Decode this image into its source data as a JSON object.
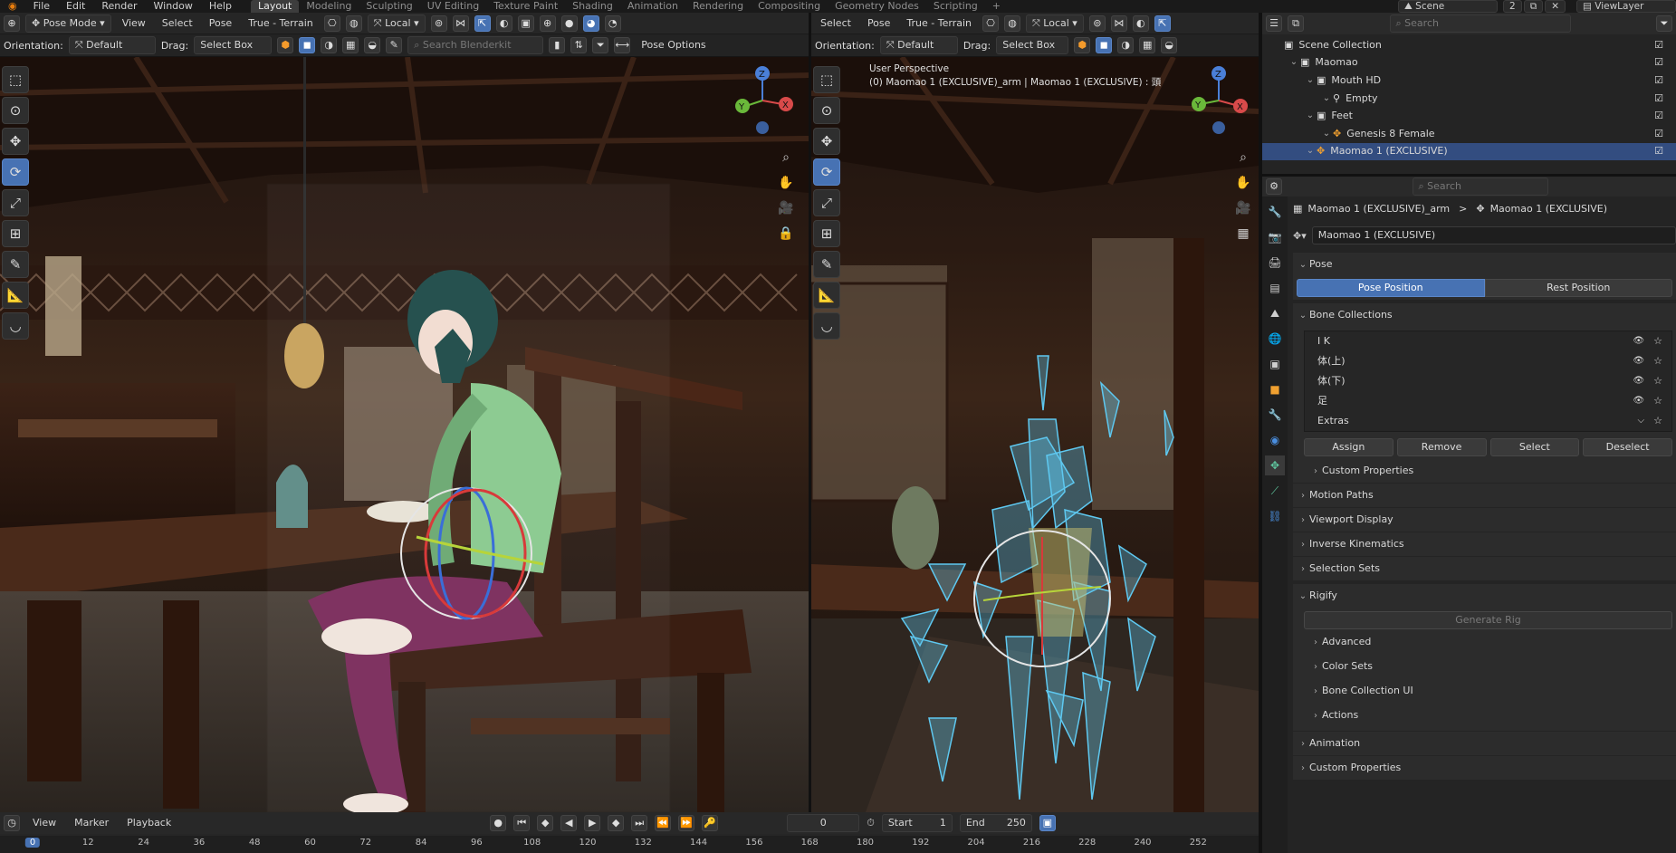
{
  "menubar": {
    "menus": [
      "File",
      "Edit",
      "Render",
      "Window",
      "Help"
    ],
    "workspaces": [
      "Layout",
      "Modeling",
      "Sculpting",
      "UV Editing",
      "Texture Paint",
      "Shading",
      "Animation",
      "Rendering",
      "Compositing",
      "Geometry Nodes",
      "Scripting"
    ],
    "active_workspace": "Layout",
    "add_workspace": "+",
    "scene_label": "Scene",
    "scene_count": "2",
    "view_layer_label": "ViewLayer"
  },
  "left_viewport": {
    "header1": {
      "mode": "Pose Mode",
      "view": "View",
      "select": "Select",
      "pose": "Pose",
      "snap_target": "True - Terrain",
      "pivot": "Local"
    },
    "header2": {
      "orientation_label": "Orientation:",
      "orientation_value": "Default",
      "drag_label": "Drag:",
      "drag_value": "Select Box",
      "search_placeholder": "Search Blenderkit",
      "pose_options": "Pose Options"
    },
    "gizmo_axes": [
      "Z",
      "X",
      "Y"
    ]
  },
  "right_viewport": {
    "header1": {
      "select": "Select",
      "pose": "Pose",
      "snap_target": "True - Terrain",
      "pivot": "Local"
    },
    "header2": {
      "orientation_label": "Orientation:",
      "orientation_value": "Default",
      "drag_label": "Drag:",
      "drag_value": "Select Box"
    },
    "overlay_line1": "User Perspective",
    "overlay_line2": "(0) Maomao 1 (EXCLUSIVE)_arm | Maomao 1 (EXCLUSIVE) : 頭",
    "gizmo_axes": [
      "Z",
      "Y",
      "X"
    ]
  },
  "outliner": {
    "search_placeholder": "Search",
    "items": [
      {
        "label": "Scene Collection",
        "indent": 0
      },
      {
        "label": "Maomao",
        "indent": 1
      },
      {
        "label": "Mouth HD",
        "indent": 2
      },
      {
        "label": "Empty",
        "indent": 3
      },
      {
        "label": "Feet",
        "indent": 2
      },
      {
        "label": "Genesis 8 Female",
        "indent": 3
      },
      {
        "label": "Maomao 1 (EXCLUSIVE)",
        "indent": 2
      }
    ]
  },
  "properties": {
    "search_placeholder": "Search",
    "breadcrumb_armature": "Maomao 1 (EXCLUSIVE)_arm",
    "breadcrumb_separator": ">",
    "breadcrumb_object": "Maomao 1 (EXCLUSIVE)",
    "datablock_name": "Maomao 1 (EXCLUSIVE)",
    "pose_section": "Pose",
    "pose_position": "Pose Position",
    "rest_position": "Rest Position",
    "bone_collections_section": "Bone Collections",
    "bone_collections": [
      "I K",
      "体(上)",
      "体(下)",
      "足",
      "Extras"
    ],
    "assign": "Assign",
    "remove": "Remove",
    "select": "Select",
    "deselect": "Deselect",
    "sections": [
      "Custom Properties",
      "Motion Paths",
      "Viewport Display",
      "Inverse Kinematics",
      "Selection Sets"
    ],
    "rigify_section": "Rigify",
    "generate_rig": "Generate Rig",
    "rigify_subsections": [
      "Advanced",
      "Color Sets",
      "Bone Collection UI",
      "Actions"
    ],
    "bottom_sections": [
      "Animation",
      "Custom Properties"
    ]
  },
  "timeline": {
    "view": "View",
    "marker": "Marker",
    "playback": "Playback",
    "current_frame": "0",
    "start_label": "Start",
    "start_value": "1",
    "end_label": "End",
    "end_value": "250",
    "ticks": [
      "0",
      "12",
      "24",
      "36",
      "48",
      "60",
      "72",
      "84",
      "96",
      "108",
      "120",
      "132",
      "144",
      "156",
      "168",
      "180",
      "192",
      "204",
      "216",
      "228",
      "240",
      "252"
    ]
  },
  "colors": {
    "accent_blue": "#4772b3",
    "selected_bone": "#5ec8f0",
    "panel_bg": "#242424"
  }
}
